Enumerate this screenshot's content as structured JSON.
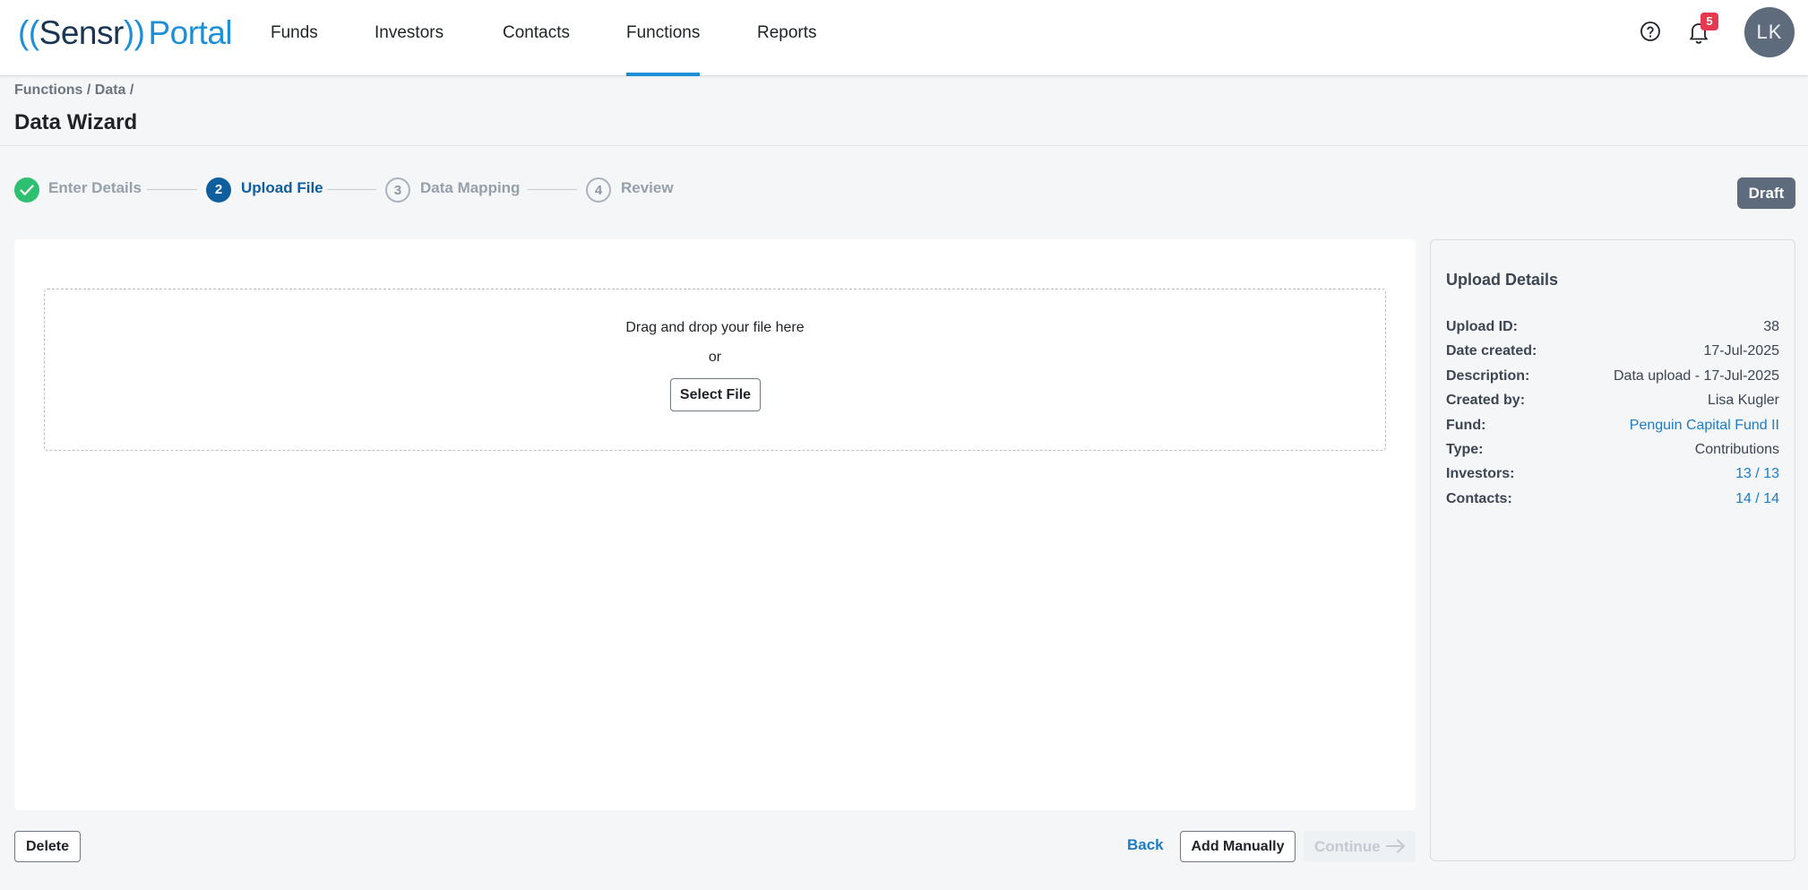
{
  "logo": {
    "open": "((",
    "name": "Sensr",
    "close": "))",
    "suffix": "Portal"
  },
  "nav": {
    "items": [
      {
        "label": "Funds"
      },
      {
        "label": "Investors"
      },
      {
        "label": "Contacts"
      },
      {
        "label": "Functions",
        "active": true
      },
      {
        "label": "Reports"
      }
    ],
    "notifications_count": "5",
    "avatar_initials": "LK"
  },
  "breadcrumb": "Functions / Data /",
  "page_title": "Data Wizard",
  "stepper": {
    "steps": [
      {
        "number": "",
        "label": "Enter Details",
        "state": "done"
      },
      {
        "number": "2",
        "label": "Upload File",
        "state": "current"
      },
      {
        "number": "3",
        "label": "Data Mapping",
        "state": "todo"
      },
      {
        "number": "4",
        "label": "Review",
        "state": "todo"
      }
    ],
    "status_badge": "Draft"
  },
  "upload": {
    "drop_text": "Drag and drop your file here",
    "or_text": "or",
    "select_label": "Select File"
  },
  "footer": {
    "delete_label": "Delete",
    "back_label": "Back",
    "add_manually_label": "Add Manually",
    "continue_label": "Continue"
  },
  "details": {
    "title": "Upload Details",
    "rows": [
      {
        "key": "Upload ID:",
        "value": "38"
      },
      {
        "key": "Date created:",
        "value": "17-Jul-2025"
      },
      {
        "key": "Description:",
        "value": "Data upload - 17-Jul-2025"
      },
      {
        "key": "Created by:",
        "value": "Lisa Kugler"
      },
      {
        "key": "Fund:",
        "value": "Penguin Capital Fund II",
        "link": true
      },
      {
        "key": "Type:",
        "value": "Contributions"
      },
      {
        "key": "Investors:",
        "value": "13 / 13",
        "link": true
      },
      {
        "key": "Contacts:",
        "value": "14 / 14",
        "link": true
      }
    ]
  },
  "colors": {
    "accent": "#1d8fd6",
    "step_current": "#0f5f9e",
    "step_done": "#2fbf71",
    "badge": "#e5394f",
    "link": "#1d7cc4"
  }
}
